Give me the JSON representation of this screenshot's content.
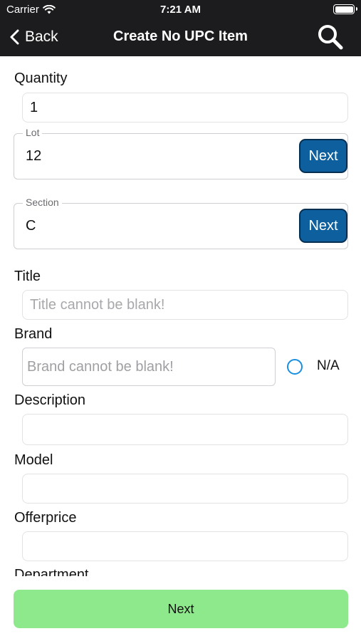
{
  "status_bar": {
    "carrier": "Carrier",
    "time": "7:21 AM"
  },
  "nav": {
    "back_label": "Back",
    "title": "Create No UPC Item",
    "search_icon": "search-icon"
  },
  "form": {
    "quantity": {
      "label": "Quantity",
      "value": "1"
    },
    "lot": {
      "legend": "Lot",
      "value": "12",
      "button": "Next"
    },
    "section": {
      "legend": "Section",
      "value": "C",
      "button": "Next"
    },
    "title": {
      "label": "Title",
      "placeholder": "Title cannot be blank!"
    },
    "brand": {
      "label": "Brand",
      "placeholder": "Brand cannot be blank!",
      "na_label": "N/A"
    },
    "description": {
      "label": "Description",
      "value": ""
    },
    "model": {
      "label": "Model",
      "value": ""
    },
    "offerprice": {
      "label": "Offerprice",
      "value": ""
    },
    "department": {
      "label": "Department"
    }
  },
  "footer": {
    "next_label": "Next"
  },
  "colors": {
    "header_bg": "#1c1c1e",
    "next_button": "#0d5f9e",
    "footer_button": "#8ee98c",
    "radio": "#1a8fe0"
  }
}
